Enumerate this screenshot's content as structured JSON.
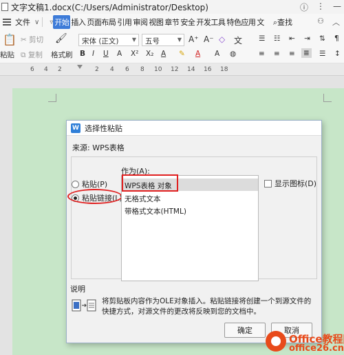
{
  "window": {
    "title": "文字文稿1.docx(C:/Users/Administrator/Desktop)",
    "icons": [
      "help-icon",
      "more-icon",
      "minimize-icon"
    ]
  },
  "menu": {
    "file_label": "文件",
    "tabs": [
      "开始",
      "插入",
      "页面布局",
      "引用",
      "审阅",
      "视图",
      "章节",
      "安全",
      "开发工具",
      "特色应用",
      "文"
    ],
    "active_tab": "开始",
    "find_label": "查找"
  },
  "toolbar": {
    "paste_label": "粘贴",
    "cut_label": "剪切",
    "copy_label": "复制",
    "format_painter_label": "格式刷",
    "font_name": "宋体 (正文)",
    "font_size": "五号"
  },
  "ruler": {
    "ticks": [
      "6",
      "4",
      "2",
      "2",
      "4",
      "6",
      "8",
      "10",
      "12",
      "14",
      "16",
      "18"
    ]
  },
  "dialog": {
    "title": "选择性粘贴",
    "source_label": "来源: WPS表格",
    "paste_option": "粘贴(P)",
    "paste_link_option": "粘贴链接(L)",
    "selected_option": "paste_link",
    "as_label": "作为(A):",
    "as_items": [
      "WPS表格 对象",
      "无格式文本",
      "带格式文本(HTML)"
    ],
    "selected_item": "WPS表格 对象",
    "show_icon_label": "显示图标(D)",
    "show_icon_checked": false,
    "description_label": "说明",
    "description_text": "将剪贴板内容作为OLE对象插入。粘贴链接将创建一个到源文件的快捷方式，对源文件的更改将反映到您的文档中。",
    "ok_label": "确定",
    "cancel_label": "取消"
  },
  "watermark": {
    "line1": "Office教程网",
    "line2": "office26.cn"
  },
  "colors": {
    "page_background": "#c7e6c8",
    "active_tab": "#3d7bd8",
    "highlight_red": "#e02020",
    "watermark_orange": "#e84a1a"
  }
}
